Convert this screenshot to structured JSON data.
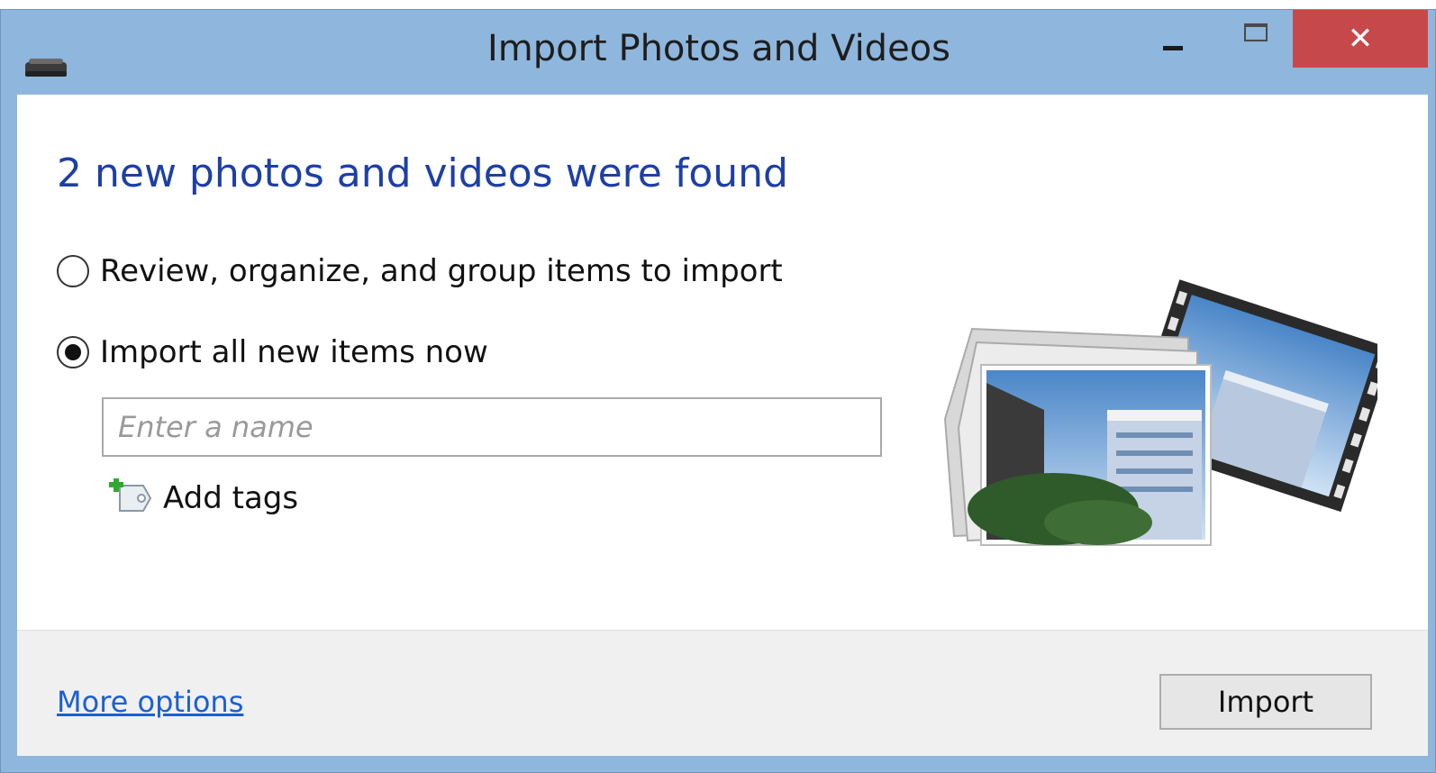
{
  "window": {
    "title": "Import Photos and Videos",
    "close_glyph": "✕",
    "titlebar_color": "#8fb6dc",
    "close_color": "#c7484a",
    "icons": [
      "device-icon",
      "minimize-icon",
      "maximize-icon",
      "close-icon"
    ]
  },
  "dialog": {
    "headline": "2 new photos and videos were found",
    "options": [
      {
        "label": "Review, organize, and group items to import",
        "selected": false
      },
      {
        "label": "Import all new items now",
        "selected": true
      }
    ],
    "name_input": {
      "value": "",
      "placeholder": "Enter a name"
    },
    "add_tags_label": "Add tags",
    "tag_icon": "tag-add-icon",
    "hero_image": "photos-and-film-illustration",
    "accent_color": "#1d3fa6"
  },
  "footer": {
    "more_options_label": "More options",
    "import_label": "Import",
    "link_color": "#1c5fd0"
  }
}
